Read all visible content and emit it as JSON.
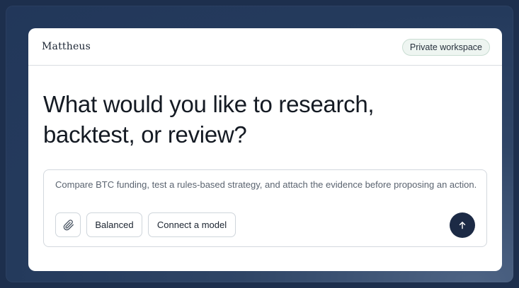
{
  "app": {
    "brand": "Mattheus",
    "workspace_badge": "Private workspace"
  },
  "main": {
    "headline": "What would you like to research, backtest, or review?"
  },
  "composer": {
    "prompt_text": "Compare BTC funding, test a rules-based strategy, and attach the evidence before proposing an action.",
    "mode_label": "Balanced",
    "model_label": "Connect a model",
    "attach_icon": "paperclip-icon",
    "send_icon": "arrow-up-icon"
  },
  "colors": {
    "page_background": "#1d2f4d",
    "send_button": "#1c2a45",
    "badge_background": "#eef5f1"
  }
}
